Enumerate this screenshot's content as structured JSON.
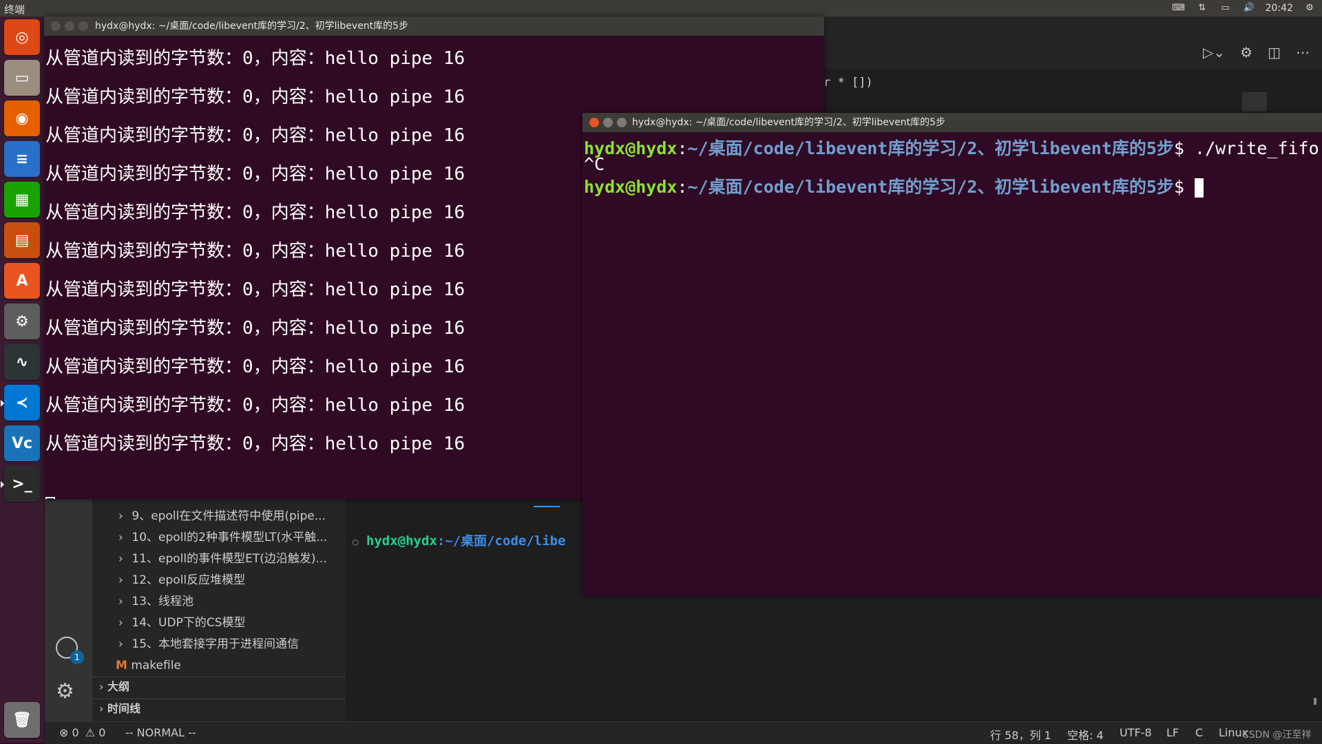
{
  "top_panel": {
    "app_title": "终端",
    "clock": "20:42"
  },
  "launcher": {
    "items": [
      {
        "name": "ubuntu-dash-icon",
        "glyph": "◎",
        "color": "#dd4814"
      },
      {
        "name": "files-icon",
        "glyph": "▭",
        "color": "#9b8e7e"
      },
      {
        "name": "firefox-icon",
        "glyph": "◉",
        "color": "#e66000"
      },
      {
        "name": "writer-icon",
        "glyph": "≡",
        "color": "#2a6fc9"
      },
      {
        "name": "calc-icon",
        "glyph": "▦",
        "color": "#18a303"
      },
      {
        "name": "impress-icon",
        "glyph": "▤",
        "color": "#c94f0f"
      },
      {
        "name": "software-center-icon",
        "glyph": "A",
        "color": "#e95420"
      },
      {
        "name": "system-settings-icon",
        "glyph": "⚙",
        "color": "#5e5e5e"
      },
      {
        "name": "system-monitor-icon",
        "glyph": "∿",
        "color": "#2d3436"
      },
      {
        "name": "vscode-icon",
        "glyph": "≺",
        "color": "#0078d4"
      },
      {
        "name": "vnc-icon",
        "glyph": "Vc",
        "color": "#1a73b8"
      },
      {
        "name": "terminal-icon",
        "glyph": ">_",
        "color": "#2b2b2b"
      },
      {
        "name": "trash-icon",
        "glyph": "🗑",
        "color": "#6e6e6e"
      }
    ]
  },
  "terminal_left": {
    "title": "hydx@hydx: ~/桌面/code/libevent库的学习/2、初学libevent库的5步",
    "lines": [
      "从管道内读到的字节数：0，内容：hello pipe 16",
      "从管道内读到的字节数：0，内容：hello pipe 16",
      "从管道内读到的字节数：0，内容：hello pipe 16",
      "从管道内读到的字节数：0，内容：hello pipe 16",
      "从管道内读到的字节数：0，内容：hello pipe 16",
      "从管道内读到的字节数：0，内容：hello pipe 16",
      "从管道内读到的字节数：0，内容：hello pipe 16",
      "从管道内读到的字节数：0，内容：hello pipe 16",
      "从管道内读到的字节数：0，内容：hello pipe 16",
      "从管道内读到的字节数：0，内容：hello pipe 16",
      "从管道内读到的字节数：0，内容：hello pipe 16"
    ]
  },
  "terminal_right": {
    "title": "hydx@hydx: ~/桌面/code/libevent库的学习/2、初学libevent库的5步",
    "prompt_user": "hydx@hydx",
    "prompt_path": "~/桌面/code/libevent库的学习/2、初学libevent库的5步",
    "prompt_symbol": "$",
    "command": "./write_fifo",
    "interrupt": "^C"
  },
  "vscode": {
    "editor_fragment": "r * [])",
    "tree_items": [
      "9、epoll在文件描述符中使用(pipe...",
      "10、epoll的2种事件模型LT(水平触...",
      "11、epoll的事件模型ET(边沿触发)...",
      "12、epoll反应堆模型",
      "13、线程池",
      "14、UDP下的CS模型",
      "15、本地套接字用于进程间通信"
    ],
    "makefile_badge": "M",
    "makefile": "makefile",
    "outline": "大纲",
    "timeline": "时间线",
    "accounts_badge": "1",
    "panel_terminal": {
      "user": "hydx@hydx",
      "path": ":~/桌面/code/libe"
    },
    "status": {
      "errors": "0",
      "warnings": "0",
      "mode": "-- NORMAL --",
      "position": "行 58，列 1",
      "spaces": "空格: 4",
      "encoding": "UTF-8",
      "eol": "LF",
      "language": "C",
      "os": "Linux",
      "watermark": "CSDN @汪至祥"
    }
  }
}
